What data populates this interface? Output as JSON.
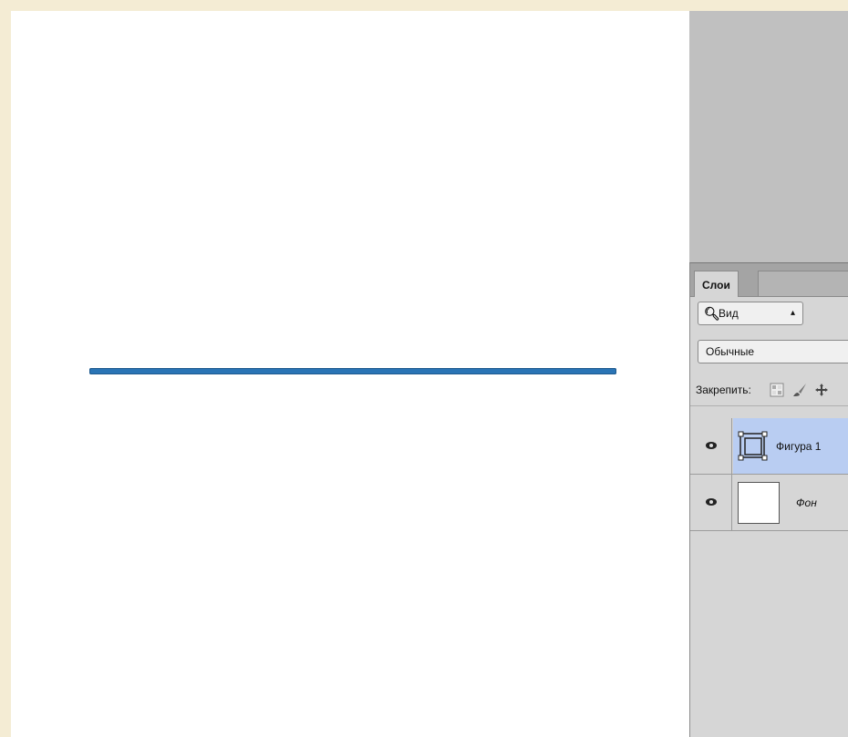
{
  "canvas": {
    "background": "#ffffff",
    "shape_color": "#2a74b5"
  },
  "layers_panel": {
    "tab_label": "Слои",
    "filter": {
      "label": "Вид",
      "icon": "search-icon"
    },
    "blend_mode": "Обычные",
    "lock_label": "Закрепить:",
    "lock_icons": [
      "lock-transparent-pixels-icon",
      "lock-image-pixels-icon",
      "lock-position-icon"
    ],
    "layers": [
      {
        "name": "Фигура 1",
        "selected": true,
        "visible": true,
        "thumbnail": "shape-layer-icon"
      },
      {
        "name": "Фон",
        "selected": false,
        "visible": true,
        "thumbnail": "white-thumbnail"
      }
    ],
    "selected_color": "#b9cdf2"
  }
}
